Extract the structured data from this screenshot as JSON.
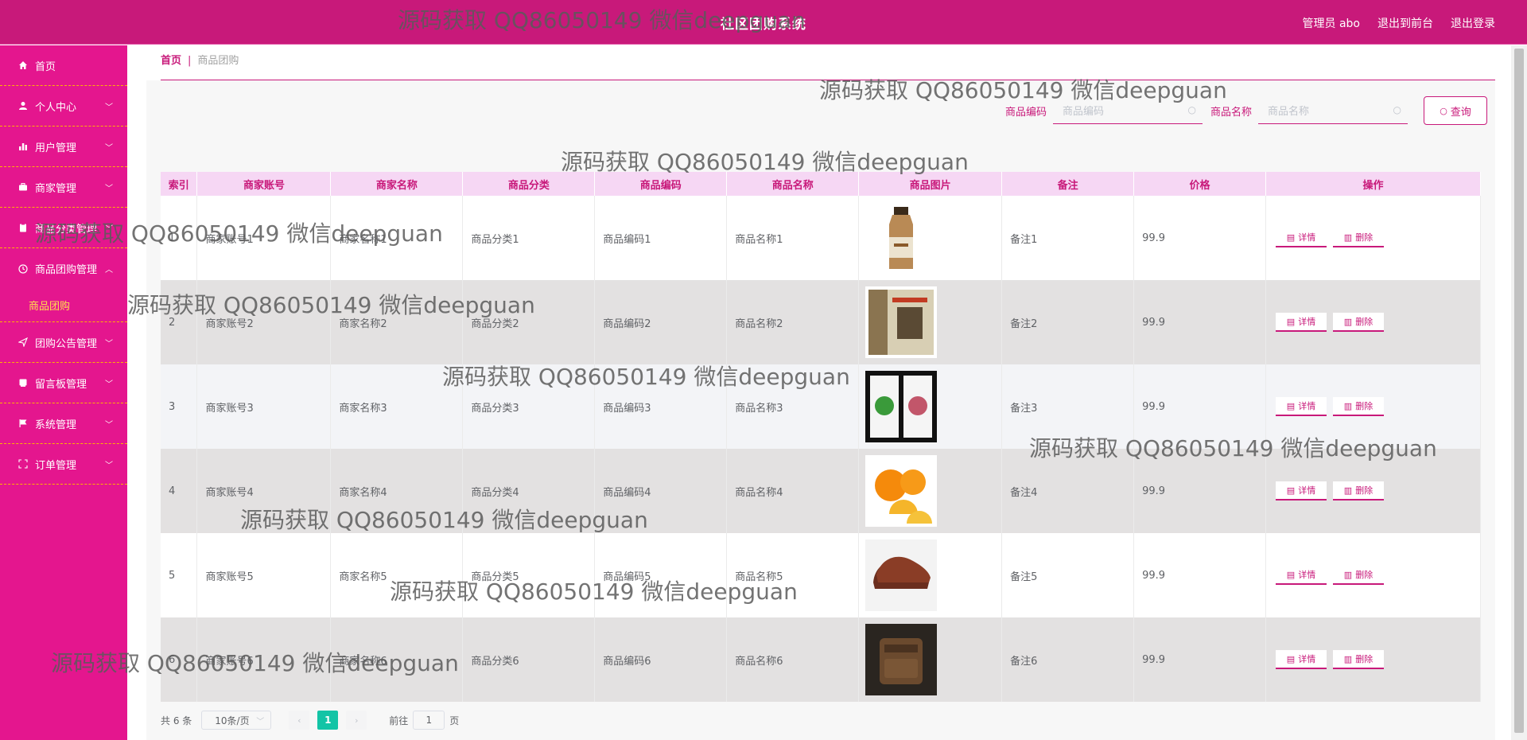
{
  "header": {
    "title": "社区团购系统",
    "admin": "管理员 abo",
    "back_front": "退出到前台",
    "logout": "退出登录"
  },
  "sidebar": {
    "items": [
      {
        "label": "首页",
        "icon": "home-icon",
        "expandable": false
      },
      {
        "label": "个人中心",
        "icon": "user-icon",
        "expandable": true
      },
      {
        "label": "用户管理",
        "icon": "bar-chart-icon",
        "expandable": true
      },
      {
        "label": "商家管理",
        "icon": "briefcase-icon",
        "expandable": true
      },
      {
        "label": "商品分类管理",
        "icon": "clipboard-icon",
        "expandable": true
      },
      {
        "label": "商品团购管理",
        "icon": "clock-icon",
        "expandable": true,
        "open": true
      },
      {
        "label": "团购公告管理",
        "icon": "send-icon",
        "expandable": true
      },
      {
        "label": "留言板管理",
        "icon": "message-icon",
        "expandable": true
      },
      {
        "label": "系统管理",
        "icon": "flag-icon",
        "expandable": true
      },
      {
        "label": "订单管理",
        "icon": "frame-icon",
        "expandable": true
      }
    ],
    "active_sub": "商品团购"
  },
  "breadcrumb": {
    "home": "首页",
    "separator": "|",
    "current": "商品团购"
  },
  "search": {
    "code_label": "商品编码",
    "code_placeholder": "商品编码",
    "name_label": "商品名称",
    "name_placeholder": "商品名称",
    "button": "查询"
  },
  "table": {
    "headers": [
      "索引",
      "商家账号",
      "商家名称",
      "商品分类",
      "商品编码",
      "商品名称",
      "商品图片",
      "备注",
      "价格",
      "操作"
    ],
    "rows": [
      {
        "index": "1",
        "account": "商家账号1",
        "merchant": "商家名称1",
        "category": "商品分类1",
        "code": "商品编码1",
        "name": "商品名称1",
        "image": "milk-bottle-image",
        "remark": "备注1",
        "price": "99.9"
      },
      {
        "index": "2",
        "account": "商家账号2",
        "merchant": "商家名称2",
        "category": "商品分类2",
        "code": "商品编码2",
        "name": "商品名称2",
        "image": "book-box-image",
        "remark": "备注2",
        "price": "99.9"
      },
      {
        "index": "3",
        "account": "商家账号3",
        "merchant": "商家名称3",
        "category": "商品分类3",
        "code": "商品编码3",
        "name": "商品名称3",
        "image": "tea-pack-image",
        "remark": "备注3",
        "price": "99.9"
      },
      {
        "index": "4",
        "account": "商家账号4",
        "merchant": "商家名称4",
        "category": "商品分类4",
        "code": "商品编码4",
        "name": "商品名称4",
        "image": "orange-image",
        "remark": "备注4",
        "price": "99.9"
      },
      {
        "index": "5",
        "account": "商家账号5",
        "merchant": "商家名称5",
        "category": "商品分类5",
        "code": "商品编码5",
        "name": "商品名称5",
        "image": "leather-shoe-image",
        "remark": "备注5",
        "price": "99.9"
      },
      {
        "index": "6",
        "account": "商家账号6",
        "merchant": "商家名称6",
        "category": "商品分类6",
        "code": "商品编码6",
        "name": "商品名称6",
        "image": "waist-bag-image",
        "remark": "备注6",
        "price": "99.9"
      }
    ],
    "detail_label": "详情",
    "delete_label": "删除"
  },
  "pagination": {
    "total": "共 6 条",
    "page_size": "10条/页",
    "current": "1",
    "goto_prefix": "前往",
    "goto_value": "1",
    "goto_suffix": "页"
  },
  "watermark": "源码获取 QQ86050149 微信deepguan",
  "colors": {
    "primary": "#c8197a",
    "sidebar": "#e4168e",
    "active": "#ffe14d",
    "pager_active": "#13c4a6"
  }
}
